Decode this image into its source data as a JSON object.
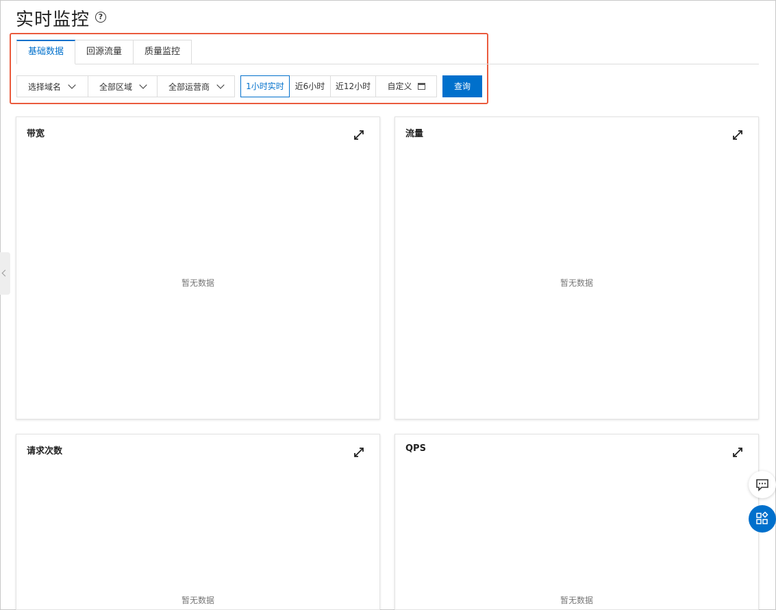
{
  "page": {
    "title": "实时监控",
    "help_symbol": "?"
  },
  "tabs": [
    {
      "label": "基础数据",
      "active": true
    },
    {
      "label": "回源流量",
      "active": false
    },
    {
      "label": "质量监控",
      "active": false
    }
  ],
  "filters": {
    "domain": "选择域名",
    "region": "全部区域",
    "isp": "全部运营商"
  },
  "time_range": {
    "options": [
      "1小时实时",
      "近6小时",
      "近12小时"
    ],
    "selected": "1小时实时",
    "custom_label": "自定义"
  },
  "query_button": "查询",
  "cards": [
    {
      "title": "带宽",
      "empty_text": "暂无数据"
    },
    {
      "title": "流量",
      "empty_text": "暂无数据"
    },
    {
      "title": "请求次数",
      "empty_text": "暂无数据"
    },
    {
      "title": "QPS",
      "empty_text": "暂无数据"
    }
  ],
  "colors": {
    "accent": "#0070cc",
    "highlight": "#ea5a3c",
    "border": "#dcdcdc"
  },
  "icons": [
    "help-icon",
    "expand-icon",
    "calendar-icon",
    "chevron-down-icon",
    "chat-icon",
    "apps-icon",
    "chevron-left-icon"
  ]
}
